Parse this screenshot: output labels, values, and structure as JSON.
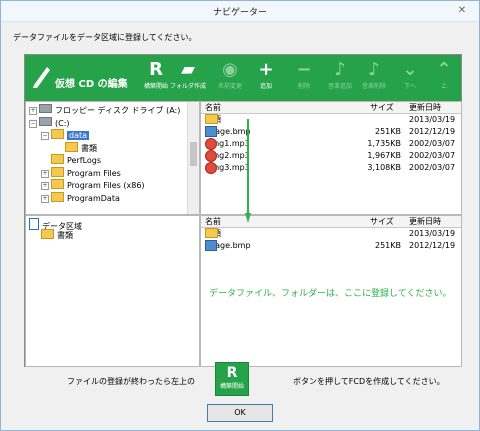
{
  "window": {
    "title": "ナビゲーター",
    "close_glyph": "✕"
  },
  "intro": "データファイルをデータ区域に登録してください。",
  "toolbar": {
    "title": "仮想 CD の編集",
    "buttons": [
      {
        "label": "構築開始",
        "icon": "build-icon",
        "glyph": "R",
        "enabled": true
      },
      {
        "label": "フォルダ作成",
        "icon": "folder-icon",
        "glyph": "▰",
        "enabled": true
      },
      {
        "label": "名前変更",
        "icon": "disc-icon",
        "glyph": "◉",
        "enabled": false
      },
      {
        "label": "追加",
        "icon": "plus-icon",
        "glyph": "+",
        "enabled": true
      },
      {
        "label": "削除",
        "icon": "minus-icon",
        "glyph": "−",
        "enabled": false
      },
      {
        "label": "音楽追加",
        "icon": "music-add-icon",
        "glyph": "♪",
        "enabled": false
      },
      {
        "label": "音楽削除",
        "icon": "music-remove-icon",
        "glyph": "♪",
        "enabled": false
      },
      {
        "label": "下へ",
        "icon": "down-icon",
        "glyph": "⌄",
        "enabled": false
      },
      {
        "label": "上",
        "icon": "up-icon",
        "glyph": "⌃",
        "enabled": false
      }
    ]
  },
  "tree": [
    {
      "label": "フロッピー ディスク ドライブ (A:)",
      "toggle": "+",
      "icon": "drive"
    },
    {
      "label": "(C:)",
      "toggle": "−",
      "icon": "drive"
    },
    {
      "label": "data",
      "toggle": "−",
      "icon": "folder",
      "selected": true
    },
    {
      "label": "書類",
      "toggle": "",
      "icon": "folder"
    },
    {
      "label": "PerfLogs",
      "toggle": "",
      "icon": "folder"
    },
    {
      "label": "Program Files",
      "toggle": "+",
      "icon": "folder"
    },
    {
      "label": "Program Files (x86)",
      "toggle": "+",
      "icon": "folder"
    },
    {
      "label": "ProgramData",
      "toggle": "+",
      "icon": "folder"
    }
  ],
  "file_list": {
    "headers": [
      "名前",
      "サイズ",
      "更新日時"
    ],
    "rows": [
      {
        "name": "書類",
        "size": "",
        "date": "2013/03/19",
        "icon": "folder"
      },
      {
        "name": "Image.bmp",
        "size": "251KB",
        "date": "2012/12/19",
        "icon": "image"
      },
      {
        "name": "song1.mp3",
        "size": "1,735KB",
        "date": "2002/03/07",
        "icon": "mp3"
      },
      {
        "name": "song2.mp3",
        "size": "1,967KB",
        "date": "2002/03/07",
        "icon": "mp3"
      },
      {
        "name": "song3.mp3",
        "size": "3,108KB",
        "date": "2002/03/07",
        "icon": "mp3"
      }
    ]
  },
  "data_area": {
    "root": "データ区域",
    "child": "書類",
    "headers": [
      "名前",
      "サイズ",
      "更新日時"
    ],
    "rows": [
      {
        "name": "書類",
        "size": "",
        "date": "2013/03/19",
        "icon": "folder"
      },
      {
        "name": "Image.bmp",
        "size": "251KB",
        "date": "2012/12/19",
        "icon": "image"
      }
    ],
    "hint": "データファイル、フォルダーは、ここに登録してください。"
  },
  "footer": {
    "text_before": "ファイルの登録が終わったら左上の",
    "text_after": "ボタンを押してFCDを作成してください。",
    "build_label": "構築開始",
    "ok_label": "OK"
  },
  "colors": {
    "accent": "#26a34a",
    "hint": "#2db34a",
    "selection": "#3a78c9"
  }
}
